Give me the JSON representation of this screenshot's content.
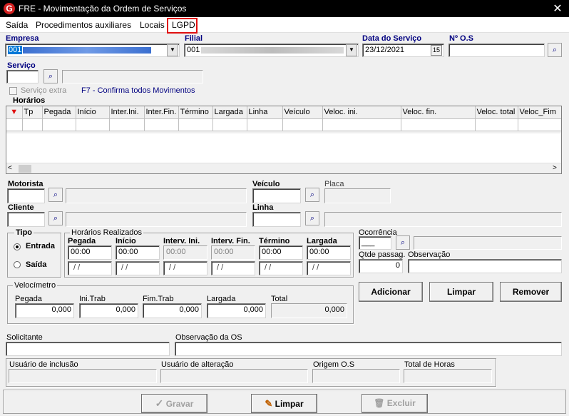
{
  "window": {
    "title": "FRE - Movimentação da Ordem de Serviços",
    "close": "✕",
    "logo": "G"
  },
  "menu": [
    "Saída",
    "Procedimentos auxiliares",
    "Locais",
    "LGPD"
  ],
  "empresa": {
    "label": "Empresa",
    "value": "001"
  },
  "filial": {
    "label": "Filial",
    "value": "001"
  },
  "data_servico": {
    "label": "Data do Serviço",
    "value": "23/12/2021",
    "cal": "15"
  },
  "num_os": {
    "label": "Nº O.S",
    "value": ""
  },
  "servico": {
    "label": "Serviço",
    "value": ""
  },
  "servico_extra": "Serviço extra",
  "f7_hint": "F7 - Confirma todos Movimentos",
  "horarios": {
    "label": "Horários",
    "columns": [
      "Tp",
      "Pegada",
      "Início",
      "Inter.Ini.",
      "Inter.Fin.",
      "Término",
      "Largada",
      "Linha",
      "Veículo",
      "Veloc. ini.",
      "Veloc. fin.",
      "Veloc. total",
      "Veloc_Fim"
    ]
  },
  "motorista": {
    "label": "Motorista"
  },
  "veiculo": {
    "label": "Veículo"
  },
  "placa": {
    "label": "Placa"
  },
  "cliente": {
    "label": "Cliente"
  },
  "linha": {
    "label": "Linha"
  },
  "tipo": {
    "label": "Tipo",
    "entrada": "Entrada",
    "saida": "Saída"
  },
  "realizados": {
    "label": "Horários Realizados",
    "cols": [
      {
        "label": "Pegada",
        "time": "00:00",
        "date": "/ /"
      },
      {
        "label": "Início",
        "time": "00:00",
        "date": "/ /"
      },
      {
        "label": "Interv. Ini.",
        "time": "00:00",
        "date": "/ /"
      },
      {
        "label": "Interv. Fin.",
        "time": "00:00",
        "date": "/ /"
      },
      {
        "label": "Término",
        "time": "00:00",
        "date": "/ /"
      },
      {
        "label": "Largada",
        "time": "00:00",
        "date": "/ /"
      }
    ]
  },
  "ocorrencia": {
    "label": "Ocorrência",
    "value": "___"
  },
  "qtde_passag": {
    "label": "Qtde passag.",
    "value": "0"
  },
  "observacao": {
    "label": "Observação"
  },
  "velocimetro": {
    "label": "Velocímetro",
    "fields": [
      {
        "label": "Pegada",
        "value": "0,000"
      },
      {
        "label": "Ini.Trab",
        "value": "0,000"
      },
      {
        "label": "Fim.Trab",
        "value": "0,000"
      },
      {
        "label": "Largada",
        "value": "0,000"
      },
      {
        "label": "Total",
        "value": "0,000"
      }
    ]
  },
  "buttons": {
    "adicionar": "Adicionar",
    "limpar": "Limpar",
    "remover": "Remover",
    "gravar": "Gravar",
    "limpar2": "Limpar",
    "excluir": "Excluir"
  },
  "solicitante": {
    "label": "Solicitante"
  },
  "obs_os": {
    "label": "Observação da OS"
  },
  "usuario_inclusao": {
    "label": "Usuário de inclusão"
  },
  "usuario_alteracao": {
    "label": "Usuário de alteração"
  },
  "origem_os": {
    "label": "Origem O.S"
  },
  "total_horas": {
    "label": "Total de Horas"
  }
}
